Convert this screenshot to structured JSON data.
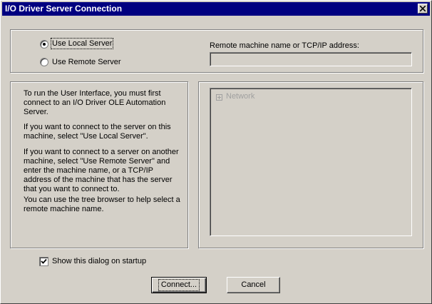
{
  "window": {
    "title": "I/O Driver Server Connection"
  },
  "server": {
    "local_label": "Use Local Server",
    "remote_label": "Use Remote Server",
    "selected": "local",
    "remote_name_label": "Remote machine name or TCP/IP address:",
    "remote_name_value": ""
  },
  "info": {
    "paragraphs": [
      "To run the User Interface, you must first connect to an  I/O Driver OLE Automation Server.",
      "If you want to connect to the server on this machine, select \"Use Local Server\".",
      "If you want to connect to a server on another machine, select \"Use Remote Server\" and enter the machine name, or a TCP/IP address of the machine that has the server that you want to connect to.",
      "You can use the tree browser to help select a remote machine name."
    ]
  },
  "tree": {
    "root_label": "Network",
    "enabled": false
  },
  "startup": {
    "label": "Show this dialog on startup",
    "checked": true
  },
  "buttons": {
    "connect": "Connect...",
    "cancel": "Cancel"
  }
}
